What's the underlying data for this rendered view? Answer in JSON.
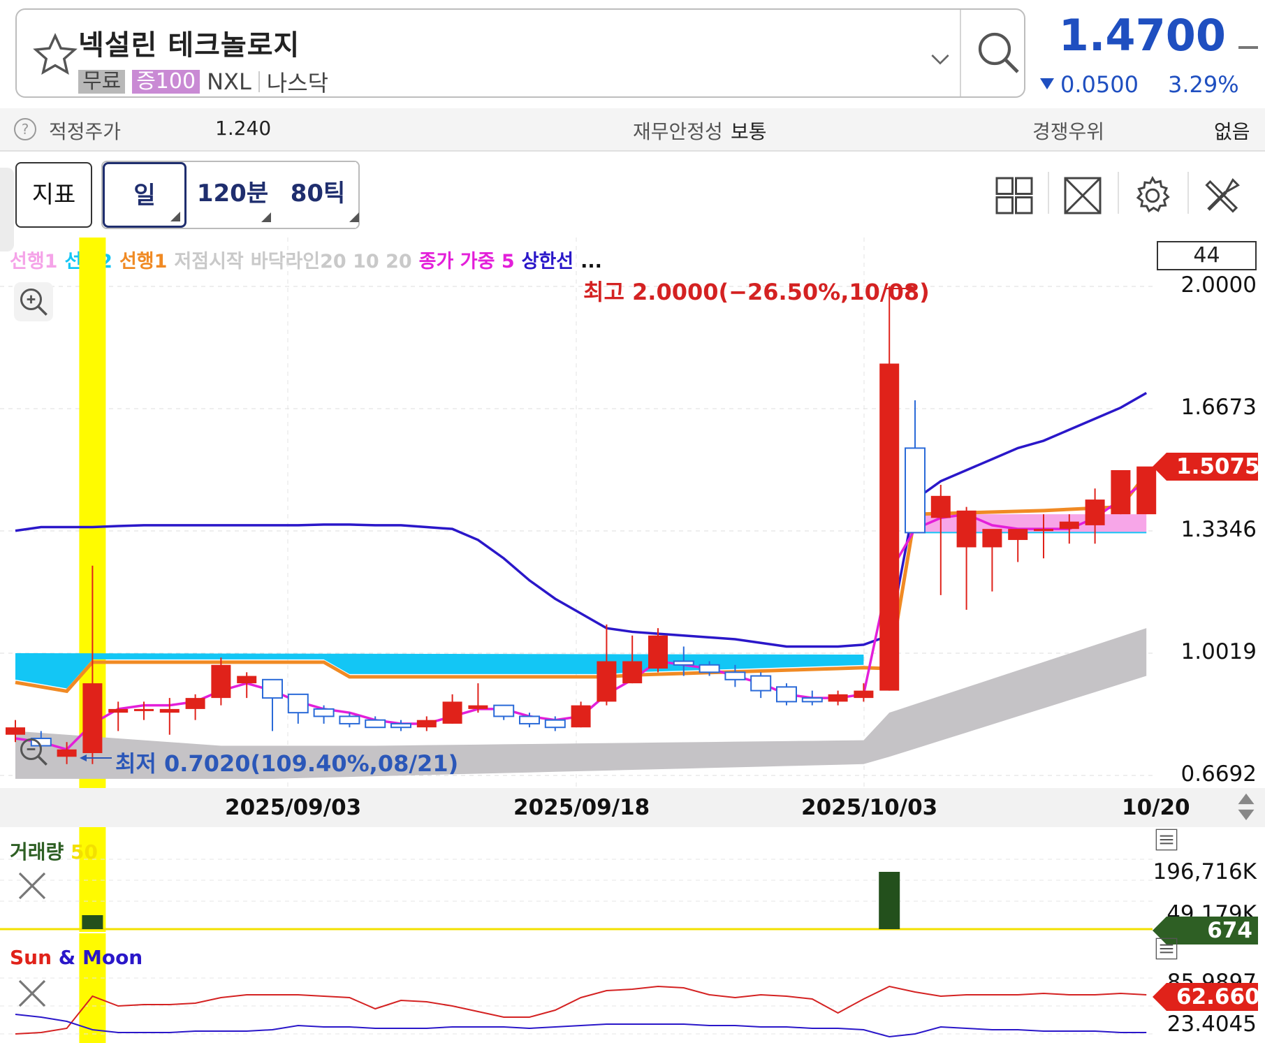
{
  "header": {
    "stock_name": "넥설린 테크놀로지",
    "tag_free": "무료",
    "tag_margin": "증100",
    "ticker": "NXL",
    "market": "나스닥",
    "price": "1.4700",
    "change_value": "0.0500",
    "change_pct": "3.29%",
    "price_color": "#1f4fc0"
  },
  "info": {
    "fair_price_label": "적정주가",
    "fair_price_value": "1.240",
    "fin_stability_label": "재무안정성",
    "fin_stability_value": "보통",
    "competitive_label": "경쟁우위",
    "competitive_value": "없음"
  },
  "toolbar": {
    "indicator": "지표",
    "day": "일",
    "min": "120분",
    "tick": "80틱",
    "icons": [
      "layout-grid-icon",
      "fullscreen-icon",
      "settings-gear-icon",
      "tools-icon"
    ]
  },
  "legend": {
    "lead1": "선행1",
    "lead2": "선행2",
    "lead1b": "선행1",
    "low_start": "저점시작",
    "bottom_line": "바닥라인20 10 20",
    "close_weighted": "종가 가중 5",
    "upper_line": "상한선",
    "more": "...",
    "count": "44"
  },
  "annotations": {
    "high": "최고 2.0000(−26.50%,10/08)",
    "low": "최저 0.7020(109.40%,08/21)"
  },
  "y_labels": [
    "2.0000",
    "1.6673",
    "1.3346",
    "1.0019",
    "0.6692"
  ],
  "current_tag": "1.5075",
  "x_labels": [
    "2025/09/03",
    "2025/09/18",
    "2025/10/03",
    "10/20"
  ],
  "volume_panel": {
    "title": "거래량",
    "period": "50",
    "y_top": "196,716K",
    "y_mid": "49,179K",
    "current": "674"
  },
  "sunmoon_panel": {
    "title_sun": "Sun",
    "title_amp": "&",
    "title_moon": "Moon",
    "y_top": "85.9897",
    "y_bottom": "23.4045",
    "current": "62.6604"
  },
  "chart_data": {
    "type": "candlestick",
    "dates": [
      "08/18",
      "08/19",
      "08/20",
      "08/21",
      "08/22",
      "08/25",
      "08/26",
      "08/27",
      "08/28",
      "08/29",
      "09/02",
      "09/03",
      "09/04",
      "09/05",
      "09/08",
      "09/09",
      "09/10",
      "09/11",
      "09/12",
      "09/15",
      "09/16",
      "09/17",
      "09/18",
      "09/19",
      "09/22",
      "09/23",
      "09/24",
      "09/25",
      "09/26",
      "09/29",
      "09/30",
      "10/01",
      "10/02",
      "10/03",
      "10/06",
      "10/07",
      "10/08",
      "10/09",
      "10/10",
      "10/13",
      "10/14",
      "10/15",
      "10/16",
      "10/17",
      "10/20"
    ],
    "ohlc": [
      [
        0.78,
        0.82,
        0.76,
        0.8
      ],
      [
        0.77,
        0.79,
        0.74,
        0.75
      ],
      [
        0.72,
        0.76,
        0.7,
        0.74
      ],
      [
        0.73,
        1.24,
        0.7,
        0.92
      ],
      [
        0.84,
        0.87,
        0.79,
        0.85
      ],
      [
        0.85,
        0.87,
        0.82,
        0.85
      ],
      [
        0.84,
        0.88,
        0.78,
        0.85
      ],
      [
        0.85,
        0.89,
        0.82,
        0.88
      ],
      [
        0.88,
        0.99,
        0.86,
        0.97
      ],
      [
        0.92,
        0.95,
        0.88,
        0.94
      ],
      [
        0.93,
        0.93,
        0.79,
        0.88
      ],
      [
        0.89,
        0.89,
        0.81,
        0.84
      ],
      [
        0.85,
        0.86,
        0.81,
        0.83
      ],
      [
        0.83,
        0.84,
        0.8,
        0.81
      ],
      [
        0.82,
        0.83,
        0.8,
        0.8
      ],
      [
        0.81,
        0.82,
        0.79,
        0.8
      ],
      [
        0.8,
        0.83,
        0.79,
        0.82
      ],
      [
        0.81,
        0.89,
        0.81,
        0.87
      ],
      [
        0.85,
        0.92,
        0.84,
        0.86
      ],
      [
        0.86,
        0.86,
        0.82,
        0.83
      ],
      [
        0.83,
        0.84,
        0.8,
        0.81
      ],
      [
        0.82,
        0.83,
        0.79,
        0.8
      ],
      [
        0.8,
        0.87,
        0.8,
        0.86
      ],
      [
        0.87,
        1.08,
        0.86,
        0.98
      ],
      [
        0.92,
        1.05,
        0.92,
        0.98
      ],
      [
        0.96,
        1.07,
        0.95,
        1.05
      ],
      [
        0.98,
        1.02,
        0.94,
        0.97
      ],
      [
        0.97,
        0.98,
        0.94,
        0.95
      ],
      [
        0.95,
        0.97,
        0.91,
        0.93
      ],
      [
        0.94,
        0.95,
        0.88,
        0.9
      ],
      [
        0.91,
        0.92,
        0.86,
        0.87
      ],
      [
        0.88,
        0.9,
        0.86,
        0.87
      ],
      [
        0.87,
        0.9,
        0.86,
        0.89
      ],
      [
        0.88,
        0.92,
        0.87,
        0.9
      ],
      [
        0.9,
        2.0,
        0.9,
        1.79
      ],
      [
        1.56,
        1.69,
        1.33,
        1.33
      ],
      [
        1.37,
        1.46,
        1.16,
        1.43
      ],
      [
        1.29,
        1.4,
        1.12,
        1.39
      ],
      [
        1.29,
        1.33,
        1.17,
        1.34
      ],
      [
        1.31,
        1.33,
        1.25,
        1.34
      ],
      [
        1.34,
        1.38,
        1.26,
        1.34
      ],
      [
        1.34,
        1.38,
        1.3,
        1.36
      ],
      [
        1.35,
        1.45,
        1.3,
        1.42
      ],
      [
        1.38,
        1.5,
        1.38,
        1.5
      ],
      [
        1.38,
        1.5,
        1.4,
        1.51
      ]
    ],
    "series": [
      {
        "name": "상한선",
        "color": "#2a17c9"
      },
      {
        "name": "종가 가중 5",
        "color": "#e31fd9"
      },
      {
        "name": "선행1",
        "color": "#f08a24"
      },
      {
        "name": "선행2",
        "color": "#13c6f5"
      }
    ],
    "ylim": [
      0.6692,
      2.0
    ],
    "colors": {
      "up": "#e0221a",
      "down": "#2a6ad8",
      "highlight": "#fffb00",
      "cloud": "#c5c3c6"
    }
  }
}
